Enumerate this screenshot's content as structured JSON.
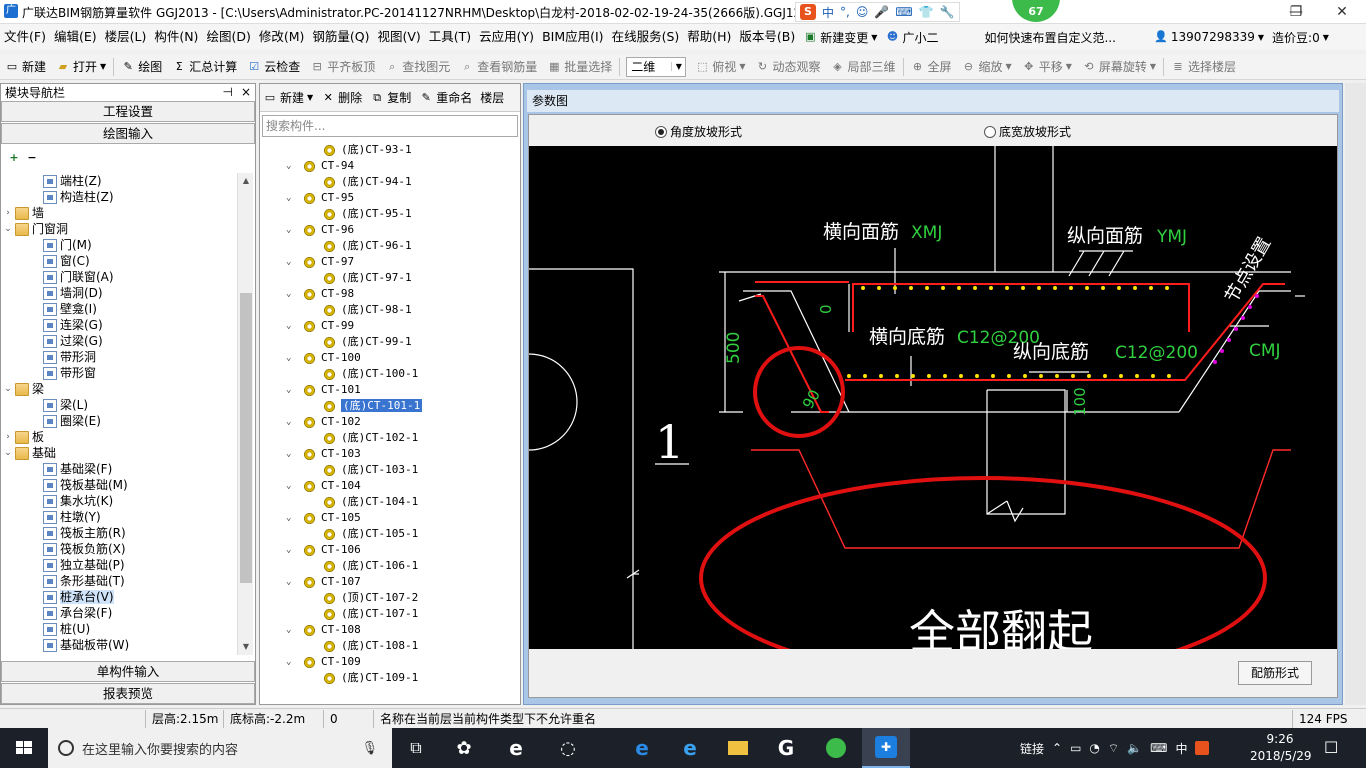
{
  "window": {
    "title": "广联达BIM钢筋算量软件 GGJ2013 - [C:\\Users\\Administrator.PC-20141127NRHM\\Desktop\\白龙村-2018-02-02-19-24-35(2666版).GGJ12]",
    "badge": "67",
    "ime": {
      "brand": "S",
      "items": [
        "中",
        "°,",
        "☺",
        "🎤",
        "⌨",
        "👕",
        "🔧"
      ]
    },
    "controls": {
      "min": "—",
      "max": "❐",
      "close": "✕"
    }
  },
  "menu": {
    "items": [
      "文件(F)",
      "编辑(E)",
      "楼层(L)",
      "构件(N)",
      "绘图(D)",
      "修改(M)",
      "钢筋量(Q)",
      "视图(V)",
      "工具(T)",
      "云应用(Y)",
      "BIM应用(I)",
      "在线服务(S)",
      "帮助(H)",
      "版本号(B)"
    ],
    "new_change": "新建变更",
    "assistant": "广小二",
    "tip": "如何快速布置自定义范...",
    "phone": "13907298339",
    "price": "造价豆:0"
  },
  "toolbar": {
    "new": "新建",
    "open": "打开",
    "draw": "绘图",
    "sum": "汇总计算",
    "cloud_check": "云检查",
    "align_top": "平齐板顶",
    "find": "查找图元",
    "view_rebar": "查看钢筋量",
    "batch": "批量选择",
    "view_mode": "二维",
    "top_view": "俯视",
    "dynamic": "动态观察",
    "local3d": "局部三维",
    "fullscreen": "全屏",
    "zoom": "缩放",
    "pan": "平移",
    "rotate": "屏幕旋转",
    "floor_select": "选择楼层"
  },
  "nav": {
    "title": "模块导航栏",
    "pin": "⊣",
    "close": "×",
    "project_settings": "工程设置",
    "draw_input": "绘图输入",
    "single_input": "单构件输入",
    "report": "报表预览",
    "tree": [
      {
        "label": "端柱(Z)",
        "level": 2,
        "type": "item"
      },
      {
        "label": "构造柱(Z)",
        "level": 2,
        "type": "item"
      },
      {
        "label": "墙",
        "level": 1,
        "type": "folder",
        "exp": "›"
      },
      {
        "label": "门窗洞",
        "level": 1,
        "type": "folder",
        "exp": "⌄"
      },
      {
        "label": "门(M)",
        "level": 2,
        "type": "item"
      },
      {
        "label": "窗(C)",
        "level": 2,
        "type": "item"
      },
      {
        "label": "门联窗(A)",
        "level": 2,
        "type": "item"
      },
      {
        "label": "墙洞(D)",
        "level": 2,
        "type": "item"
      },
      {
        "label": "壁龛(I)",
        "level": 2,
        "type": "item"
      },
      {
        "label": "连梁(G)",
        "level": 2,
        "type": "item"
      },
      {
        "label": "过梁(G)",
        "level": 2,
        "type": "item"
      },
      {
        "label": "带形洞",
        "level": 2,
        "type": "item"
      },
      {
        "label": "带形窗",
        "level": 2,
        "type": "item"
      },
      {
        "label": "梁",
        "level": 1,
        "type": "folder",
        "exp": "⌄"
      },
      {
        "label": "梁(L)",
        "level": 2,
        "type": "item"
      },
      {
        "label": "圈梁(E)",
        "level": 2,
        "type": "item"
      },
      {
        "label": "板",
        "level": 1,
        "type": "folder",
        "exp": "›"
      },
      {
        "label": "基础",
        "level": 1,
        "type": "folder",
        "exp": "⌄"
      },
      {
        "label": "基础梁(F)",
        "level": 2,
        "type": "item"
      },
      {
        "label": "筏板基础(M)",
        "level": 2,
        "type": "item"
      },
      {
        "label": "集水坑(K)",
        "level": 2,
        "type": "item"
      },
      {
        "label": "柱墩(Y)",
        "level": 2,
        "type": "item"
      },
      {
        "label": "筏板主筋(R)",
        "level": 2,
        "type": "item"
      },
      {
        "label": "筏板负筋(X)",
        "level": 2,
        "type": "item"
      },
      {
        "label": "独立基础(P)",
        "level": 2,
        "type": "item"
      },
      {
        "label": "条形基础(T)",
        "level": 2,
        "type": "item"
      },
      {
        "label": "桩承台(V)",
        "level": 2,
        "type": "item",
        "selected": true
      },
      {
        "label": "承台梁(F)",
        "level": 2,
        "type": "item"
      },
      {
        "label": "桩(U)",
        "level": 2,
        "type": "item"
      },
      {
        "label": "基础板带(W)",
        "level": 2,
        "type": "item"
      }
    ]
  },
  "components": {
    "toolbar": {
      "new": "新建",
      "delete": "删除",
      "copy": "复制",
      "rename": "重命名",
      "floor": "楼层"
    },
    "search_placeholder": "搜索构件...",
    "list": [
      {
        "label": "(底)CT-93-1",
        "level": 2
      },
      {
        "label": "CT-94",
        "level": 1
      },
      {
        "label": "(底)CT-94-1",
        "level": 2
      },
      {
        "label": "CT-95",
        "level": 1
      },
      {
        "label": "(底)CT-95-1",
        "level": 2
      },
      {
        "label": "CT-96",
        "level": 1
      },
      {
        "label": "(底)CT-96-1",
        "level": 2
      },
      {
        "label": "CT-97",
        "level": 1
      },
      {
        "label": "(底)CT-97-1",
        "level": 2
      },
      {
        "label": "CT-98",
        "level": 1
      },
      {
        "label": "(底)CT-98-1",
        "level": 2
      },
      {
        "label": "CT-99",
        "level": 1
      },
      {
        "label": "(底)CT-99-1",
        "level": 2
      },
      {
        "label": "CT-100",
        "level": 1
      },
      {
        "label": "(底)CT-100-1",
        "level": 2
      },
      {
        "label": "CT-101",
        "level": 1
      },
      {
        "label": "(底)CT-101-1",
        "level": 2,
        "selected": true
      },
      {
        "label": "CT-102",
        "level": 1
      },
      {
        "label": "(底)CT-102-1",
        "level": 2
      },
      {
        "label": "CT-103",
        "level": 1
      },
      {
        "label": "(底)CT-103-1",
        "level": 2
      },
      {
        "label": "CT-104",
        "level": 1
      },
      {
        "label": "(底)CT-104-1",
        "level": 2
      },
      {
        "label": "CT-105",
        "level": 1
      },
      {
        "label": "(底)CT-105-1",
        "level": 2
      },
      {
        "label": "CT-106",
        "level": 1
      },
      {
        "label": "(底)CT-106-1",
        "level": 2
      },
      {
        "label": "CT-107",
        "level": 1
      },
      {
        "label": "(顶)CT-107-2",
        "level": 2
      },
      {
        "label": "(底)CT-107-1",
        "level": 2
      },
      {
        "label": "CT-108",
        "level": 1
      },
      {
        "label": "(底)CT-108-1",
        "level": 2
      },
      {
        "label": "CT-109",
        "level": 1
      },
      {
        "label": "(底)CT-109-1",
        "level": 2
      }
    ]
  },
  "param": {
    "title": "参数图",
    "radio_angle": "角度放坡形式",
    "radio_width": "底宽放坡形式",
    "config_button": "配筋形式",
    "drawing": {
      "xmj_label": "横向面筋",
      "xmj_code": "XMJ",
      "ymj_label": "纵向面筋",
      "ymj_code": "YMJ",
      "node": "节点设置",
      "cmj": "CMJ",
      "xdj_label": "横向底筋",
      "xdj_code": "C12@200",
      "ydj_label": "纵向底筋",
      "ydj_code": "C12@200",
      "dim_500": "500",
      "dim_0": "0",
      "dim_100": "100",
      "angle": "90",
      "big_1": "1",
      "annotation": "全部翻起"
    }
  },
  "status": {
    "floor_height": "层高:2.15m",
    "bottom_elev": "底标高:-2.2m",
    "value": "0",
    "message": "名称在当前层当前构件类型下不允许重名",
    "fps": "124 FPS"
  },
  "taskbar": {
    "search_placeholder": "在这里输入你要搜索的内容",
    "tray_link": "链接",
    "tray_lang": "中",
    "time": "9:26",
    "date": "2018/5/29"
  },
  "colors": {
    "canvas": "#000000",
    "rebar_red": "#ff2020",
    "dim_green": "#30d040",
    "dot_yellow": "#ffe000",
    "highlight_red": "#e01010"
  }
}
